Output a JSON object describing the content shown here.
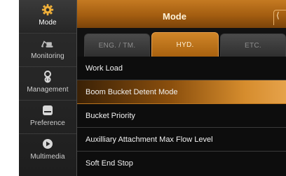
{
  "sidebar": {
    "items": [
      {
        "label": "Mode",
        "icon": "gear-icon",
        "active": true
      },
      {
        "label": "Monitoring",
        "icon": "excavator-icon",
        "active": false
      },
      {
        "label": "Management",
        "icon": "wrench-icon",
        "active": false
      },
      {
        "label": "Preference",
        "icon": "display-icon",
        "active": false
      },
      {
        "label": "Multimedia",
        "icon": "play-icon",
        "active": false
      }
    ]
  },
  "header": {
    "title": "Mode",
    "corner_glyph": "⟨"
  },
  "tabs": [
    {
      "label": "ENG. / TM.",
      "active": false
    },
    {
      "label": "HYD.",
      "active": true
    },
    {
      "label": "ETC.",
      "active": false
    }
  ],
  "menu": {
    "items": [
      {
        "label": "Work Load",
        "selected": false
      },
      {
        "label": "Boom Bucket Detent Mode",
        "selected": true
      },
      {
        "label": "Bucket Priority",
        "selected": false
      },
      {
        "label": "Auxilliary Attachment Max Flow Level",
        "selected": false
      },
      {
        "label": "Soft End Stop",
        "selected": false
      }
    ]
  },
  "colors": {
    "accent": "#c57a22",
    "accent_icon": "#f0b03a",
    "background": "#0b0b0b",
    "text": "#f2f2f2"
  }
}
